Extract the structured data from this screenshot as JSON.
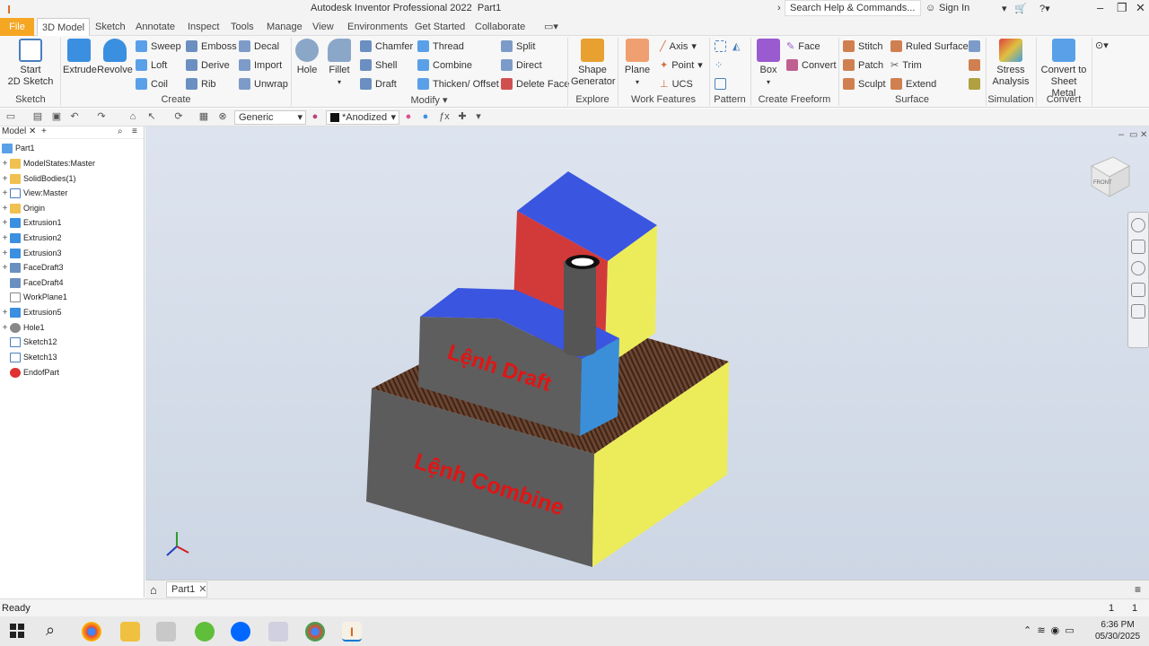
{
  "title": {
    "app_title": "Autodesk Inventor Professional 2022",
    "doc": "Part1"
  },
  "search": {
    "placeholder": "Search Help & Commands..."
  },
  "account": {
    "sign_in": "Sign In"
  },
  "menu": {
    "tabs": [
      "File",
      "3D Model",
      "Sketch",
      "Annotate",
      "Inspect",
      "Tools",
      "Manage",
      "View",
      "Environments",
      "Get Started",
      "Collaborate"
    ],
    "active": "3D Model"
  },
  "ribbon": {
    "sketch": {
      "start": "Start",
      "sketch2d": "2D Sketch",
      "label": "Sketch"
    },
    "create": {
      "extrude": "Extrude",
      "revolve": "Revolve",
      "sweep": "Sweep",
      "emboss": "Emboss",
      "decal": "Decal",
      "loft": "Loft",
      "derive": "Derive",
      "import": "Import",
      "coil": "Coil",
      "rib": "Rib",
      "unwrap": "Unwrap",
      "label": "Create"
    },
    "modify": {
      "hole": "Hole",
      "fillet": "Fillet",
      "chamfer": "Chamfer",
      "thread": "Thread",
      "split": "Split",
      "shell": "Shell",
      "combine": "Combine",
      "direct": "Direct",
      "draft": "Draft",
      "thicken": "Thicken/ Offset",
      "delete_face": "Delete Face",
      "label": "Modify"
    },
    "explore": {
      "shape1": "Shape",
      "shape2": "Generator",
      "label": "Explore"
    },
    "work": {
      "plane": "Plane",
      "axis": "Axis",
      "point": "Point",
      "ucs": "UCS",
      "label": "Work Features"
    },
    "pattern": {
      "label": "Pattern"
    },
    "freeform": {
      "box": "Box",
      "face": "Face",
      "convert": "Convert",
      "label": "Create Freeform"
    },
    "surface": {
      "stitch": "Stitch",
      "ruled": "Ruled Surface",
      "patch": "Patch",
      "trim": "Trim",
      "sculpt": "Sculpt",
      "extend": "Extend",
      "label": "Surface"
    },
    "simulation": {
      "stress1": "Stress",
      "stress2": "Analysis",
      "label": "Simulation"
    },
    "convert": {
      "c1": "Convert to",
      "c2": "Sheet Metal",
      "label": "Convert"
    }
  },
  "qat": {
    "material": "Generic",
    "appearance": "*Anodized"
  },
  "browser": {
    "tab": "Model",
    "items": [
      "Part1",
      "ModelStates:Master",
      "SolidBodies(1)",
      "View:Master",
      "Origin",
      "Extrusion1",
      "Extrusion2",
      "Extrusion3",
      "FaceDraft3",
      "FaceDraft4",
      "WorkPlane1",
      "Extrusion5",
      "Hole1",
      "Sketch12",
      "Sketch13",
      "EndofPart"
    ]
  },
  "viewport": {
    "text_draft": "Lệnh Draft",
    "text_combine": "Lệnh Combine",
    "viewcube": "FRONT"
  },
  "doc_tab": {
    "name": "Part1"
  },
  "status": {
    "text": "Ready",
    "n1": "1",
    "n2": "1"
  },
  "clock": {
    "time": "6:36 PM",
    "date": "05/30/2025"
  },
  "colors": {
    "file_tab": "#f5a623",
    "blue": "#3a55e0",
    "red_face": "#d23a3a",
    "yellow": "#ecec5a",
    "dark_gray": "#5a5a5a"
  }
}
